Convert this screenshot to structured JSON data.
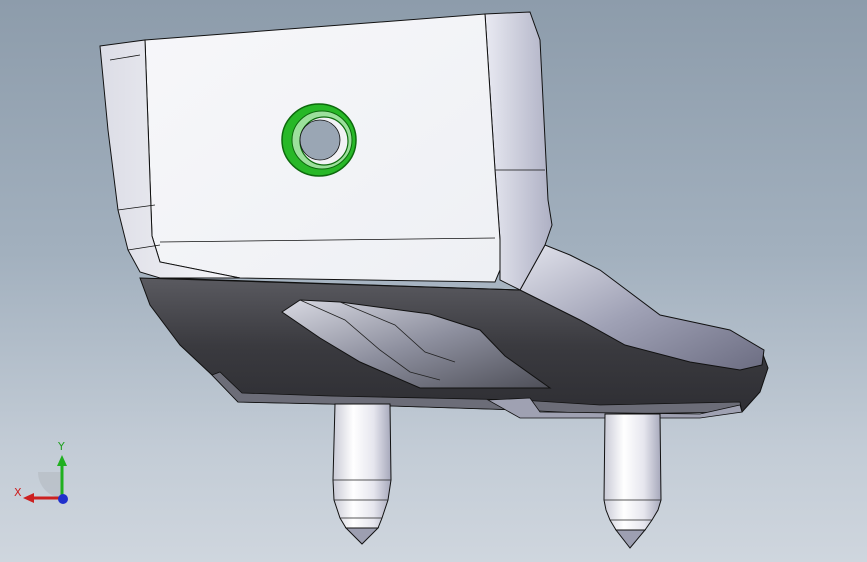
{
  "viewport": {
    "background_top": "#8d9cab",
    "background_bottom": "#cfd6de",
    "part_face_color": "#f4f4f7",
    "part_shadow_color": "#3c3c41",
    "highlight_edge_color": "#27b827"
  },
  "triad": {
    "x_label": "X",
    "y_label": "Y",
    "x_color": "#cc2020",
    "y_color": "#20b020",
    "z_color": "#2030cc"
  }
}
